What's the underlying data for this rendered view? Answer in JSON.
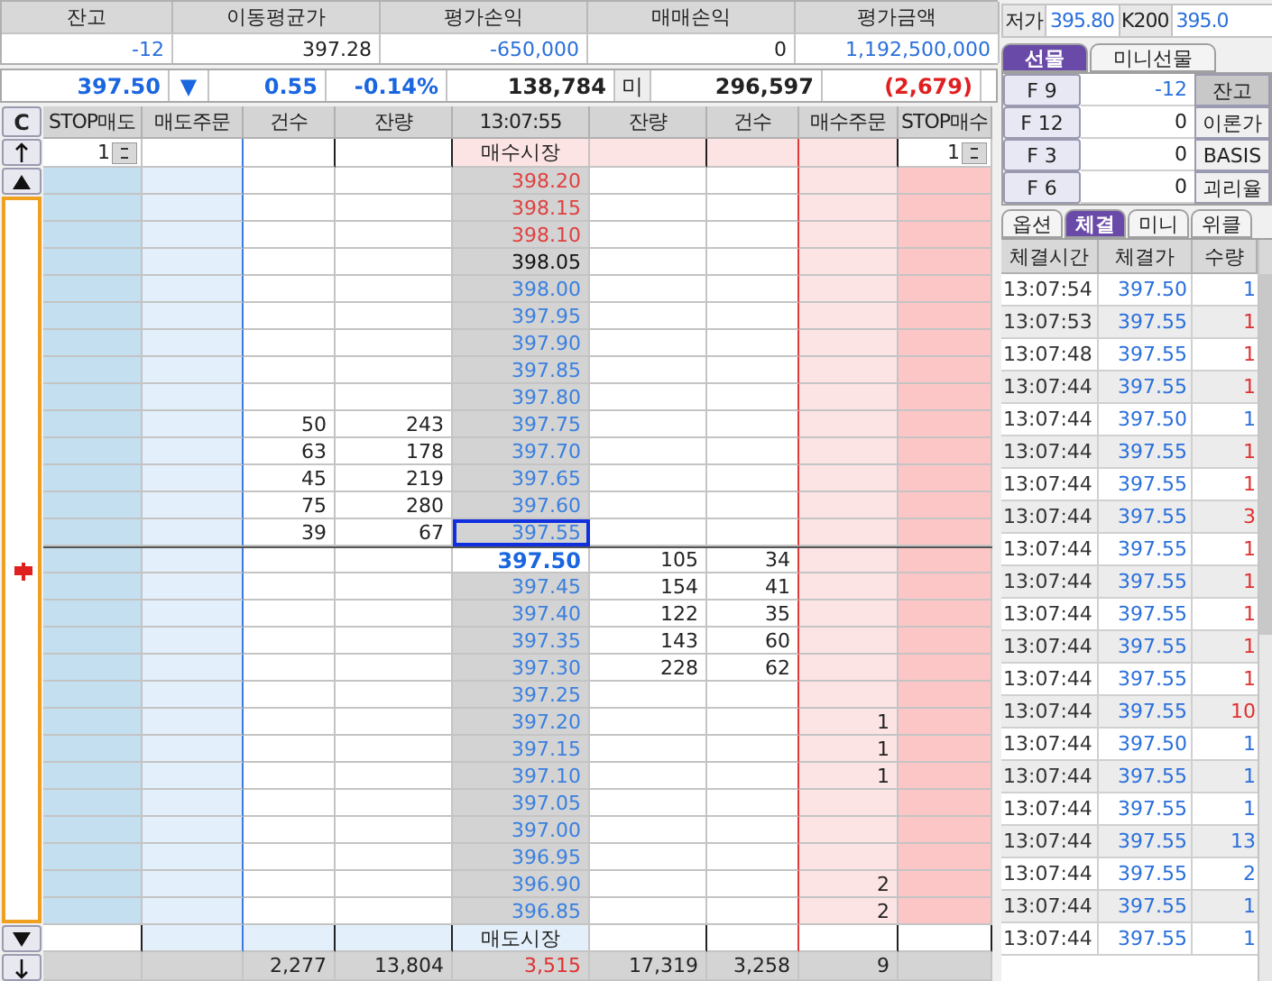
{
  "summary": {
    "columns": [
      "잔고",
      "이동평균가",
      "평가손익",
      "매매손익",
      "평가금액"
    ],
    "values": [
      {
        "text": "-12",
        "color": "#2a6fdb"
      },
      {
        "text": "397.28",
        "color": "#222222"
      },
      {
        "text": "-650,000",
        "color": "#2a6fdb"
      },
      {
        "text": "0",
        "color": "#222222"
      },
      {
        "text": "1,192,500,000",
        "color": "#2a6fdb"
      }
    ]
  },
  "quote": [
    {
      "kind": "value",
      "text": "397.50",
      "color": "#1a66e0"
    },
    {
      "kind": "arrow",
      "text": "▼",
      "color": "#1a66e0"
    },
    {
      "kind": "value",
      "text": "0.55",
      "color": "#1a66e0"
    },
    {
      "kind": "value",
      "text": "-0.14%",
      "color": "#1a66e0"
    },
    {
      "kind": "value",
      "text": "138,784",
      "color": "#222222"
    },
    {
      "kind": "label",
      "text": "미",
      "color": "#222222"
    },
    {
      "kind": "value",
      "text": "296,597",
      "color": "#222222"
    },
    {
      "kind": "value",
      "text": "(2,679)",
      "color": "#e02020"
    }
  ],
  "orderbook": {
    "reset_button": "C",
    "columns": [
      "STOP매도",
      "매도주문",
      "건수",
      "잔량",
      "13:07:55",
      "잔량",
      "건수",
      "매수주문",
      "STOP매수"
    ],
    "buy_market": {
      "label": "매수시장",
      "stop_sell_qty": "1",
      "stop_buy_qty": "1"
    },
    "rows": [
      {
        "price": "398.20",
        "color": "#e04040",
        "ask_count": "",
        "ask_qty": "",
        "bid_qty": "",
        "bid_count": "",
        "buy_order": "",
        "current": false,
        "selected": false
      },
      {
        "price": "398.15",
        "color": "#e04040",
        "ask_count": "",
        "ask_qty": "",
        "bid_qty": "",
        "bid_count": "",
        "buy_order": "",
        "current": false,
        "selected": false
      },
      {
        "price": "398.10",
        "color": "#e04040",
        "ask_count": "",
        "ask_qty": "",
        "bid_qty": "",
        "bid_count": "",
        "buy_order": "",
        "current": false,
        "selected": false
      },
      {
        "price": "398.05",
        "color": "#111111",
        "ask_count": "",
        "ask_qty": "",
        "bid_qty": "",
        "bid_count": "",
        "buy_order": "",
        "current": false,
        "selected": false
      },
      {
        "price": "398.00",
        "color": "#3a80e0",
        "ask_count": "",
        "ask_qty": "",
        "bid_qty": "",
        "bid_count": "",
        "buy_order": "",
        "current": false,
        "selected": false
      },
      {
        "price": "397.95",
        "color": "#3a80e0",
        "ask_count": "",
        "ask_qty": "",
        "bid_qty": "",
        "bid_count": "",
        "buy_order": "",
        "current": false,
        "selected": false
      },
      {
        "price": "397.90",
        "color": "#3a80e0",
        "ask_count": "",
        "ask_qty": "",
        "bid_qty": "",
        "bid_count": "",
        "buy_order": "",
        "current": false,
        "selected": false
      },
      {
        "price": "397.85",
        "color": "#3a80e0",
        "ask_count": "",
        "ask_qty": "",
        "bid_qty": "",
        "bid_count": "",
        "buy_order": "",
        "current": false,
        "selected": false
      },
      {
        "price": "397.80",
        "color": "#3a80e0",
        "ask_count": "",
        "ask_qty": "",
        "bid_qty": "",
        "bid_count": "",
        "buy_order": "",
        "current": false,
        "selected": false
      },
      {
        "price": "397.75",
        "color": "#3a80e0",
        "ask_count": "50",
        "ask_qty": "243",
        "bid_qty": "",
        "bid_count": "",
        "buy_order": "",
        "current": false,
        "selected": false
      },
      {
        "price": "397.70",
        "color": "#3a80e0",
        "ask_count": "63",
        "ask_qty": "178",
        "bid_qty": "",
        "bid_count": "",
        "buy_order": "",
        "current": false,
        "selected": false
      },
      {
        "price": "397.65",
        "color": "#3a80e0",
        "ask_count": "45",
        "ask_qty": "219",
        "bid_qty": "",
        "bid_count": "",
        "buy_order": "",
        "current": false,
        "selected": false
      },
      {
        "price": "397.60",
        "color": "#3a80e0",
        "ask_count": "75",
        "ask_qty": "280",
        "bid_qty": "",
        "bid_count": "",
        "buy_order": "",
        "current": false,
        "selected": false
      },
      {
        "price": "397.55",
        "color": "#3a80e0",
        "ask_count": "39",
        "ask_qty": "67",
        "bid_qty": "",
        "bid_count": "",
        "buy_order": "",
        "current": false,
        "selected": true
      },
      {
        "price": "397.50",
        "color": "#1a66e0",
        "ask_count": "",
        "ask_qty": "",
        "bid_qty": "105",
        "bid_count": "34",
        "buy_order": "",
        "current": true,
        "selected": false
      },
      {
        "price": "397.45",
        "color": "#3a80e0",
        "ask_count": "",
        "ask_qty": "",
        "bid_qty": "154",
        "bid_count": "41",
        "buy_order": "",
        "current": false,
        "selected": false
      },
      {
        "price": "397.40",
        "color": "#3a80e0",
        "ask_count": "",
        "ask_qty": "",
        "bid_qty": "122",
        "bid_count": "35",
        "buy_order": "",
        "current": false,
        "selected": false
      },
      {
        "price": "397.35",
        "color": "#3a80e0",
        "ask_count": "",
        "ask_qty": "",
        "bid_qty": "143",
        "bid_count": "60",
        "buy_order": "",
        "current": false,
        "selected": false
      },
      {
        "price": "397.30",
        "color": "#3a80e0",
        "ask_count": "",
        "ask_qty": "",
        "bid_qty": "228",
        "bid_count": "62",
        "buy_order": "",
        "current": false,
        "selected": false
      },
      {
        "price": "397.25",
        "color": "#3a80e0",
        "ask_count": "",
        "ask_qty": "",
        "bid_qty": "",
        "bid_count": "",
        "buy_order": "",
        "current": false,
        "selected": false
      },
      {
        "price": "397.20",
        "color": "#3a80e0",
        "ask_count": "",
        "ask_qty": "",
        "bid_qty": "",
        "bid_count": "",
        "buy_order": "1",
        "current": false,
        "selected": false
      },
      {
        "price": "397.15",
        "color": "#3a80e0",
        "ask_count": "",
        "ask_qty": "",
        "bid_qty": "",
        "bid_count": "",
        "buy_order": "1",
        "current": false,
        "selected": false
      },
      {
        "price": "397.10",
        "color": "#3a80e0",
        "ask_count": "",
        "ask_qty": "",
        "bid_qty": "",
        "bid_count": "",
        "buy_order": "1",
        "current": false,
        "selected": false
      },
      {
        "price": "397.05",
        "color": "#3a80e0",
        "ask_count": "",
        "ask_qty": "",
        "bid_qty": "",
        "bid_count": "",
        "buy_order": "",
        "current": false,
        "selected": false
      },
      {
        "price": "397.00",
        "color": "#3a80e0",
        "ask_count": "",
        "ask_qty": "",
        "bid_qty": "",
        "bid_count": "",
        "buy_order": "",
        "current": false,
        "selected": false
      },
      {
        "price": "396.95",
        "color": "#3a80e0",
        "ask_count": "",
        "ask_qty": "",
        "bid_qty": "",
        "bid_count": "",
        "buy_order": "",
        "current": false,
        "selected": false
      },
      {
        "price": "396.90",
        "color": "#3a80e0",
        "ask_count": "",
        "ask_qty": "",
        "bid_qty": "",
        "bid_count": "",
        "buy_order": "2",
        "current": false,
        "selected": false
      },
      {
        "price": "396.85",
        "color": "#3a80e0",
        "ask_count": "",
        "ask_qty": "",
        "bid_qty": "",
        "bid_count": "",
        "buy_order": "2",
        "current": false,
        "selected": false
      }
    ],
    "sell_market": "매도시장",
    "totals": {
      "ask_count": "2,277",
      "ask_qty": "13,804",
      "net": "3,515",
      "bid_qty": "17,319",
      "bid_count": "3,258",
      "buy_order": "9"
    }
  },
  "quote_strip": [
    {
      "label": "저가",
      "value": "395.80"
    },
    {
      "label": "K200",
      "value": "395.0"
    }
  ],
  "product_tabs": [
    {
      "label": "선물",
      "selected": true
    },
    {
      "label": "미니선물",
      "selected": false
    }
  ],
  "futures": [
    {
      "label": "F 9",
      "value": "-12",
      "color": "#2a6fdb",
      "button": "잔고",
      "selected": true
    },
    {
      "label": "F 12",
      "value": "0",
      "color": "#222222",
      "button": "이론가",
      "selected": false
    },
    {
      "label": "F 3",
      "value": "0",
      "color": "#222222",
      "button": "BASIS",
      "selected": false
    },
    {
      "label": "F 6",
      "value": "0",
      "color": "#222222",
      "button": "괴리율",
      "selected": false
    }
  ],
  "view_tabs": [
    {
      "label": "옵션",
      "selected": false
    },
    {
      "label": "체결",
      "selected": true
    },
    {
      "label": "미니",
      "selected": false
    },
    {
      "label": "위클",
      "selected": false
    }
  ],
  "trades": {
    "columns": [
      "체결시간",
      "체결가",
      "수량"
    ],
    "rows": [
      {
        "time": "13:07:54",
        "price": "397.50",
        "qty": "1",
        "color": "#2a6fdb"
      },
      {
        "time": "13:07:53",
        "price": "397.55",
        "qty": "1",
        "color": "#e03030"
      },
      {
        "time": "13:07:48",
        "price": "397.55",
        "qty": "1",
        "color": "#e03030"
      },
      {
        "time": "13:07:44",
        "price": "397.55",
        "qty": "1",
        "color": "#e03030"
      },
      {
        "time": "13:07:44",
        "price": "397.50",
        "qty": "1",
        "color": "#2a6fdb"
      },
      {
        "time": "13:07:44",
        "price": "397.55",
        "qty": "1",
        "color": "#e03030"
      },
      {
        "time": "13:07:44",
        "price": "397.55",
        "qty": "1",
        "color": "#e03030"
      },
      {
        "time": "13:07:44",
        "price": "397.55",
        "qty": "3",
        "color": "#e03030"
      },
      {
        "time": "13:07:44",
        "price": "397.55",
        "qty": "1",
        "color": "#e03030"
      },
      {
        "time": "13:07:44",
        "price": "397.55",
        "qty": "1",
        "color": "#e03030"
      },
      {
        "time": "13:07:44",
        "price": "397.55",
        "qty": "1",
        "color": "#e03030"
      },
      {
        "time": "13:07:44",
        "price": "397.55",
        "qty": "1",
        "color": "#e03030"
      },
      {
        "time": "13:07:44",
        "price": "397.55",
        "qty": "1",
        "color": "#e03030"
      },
      {
        "time": "13:07:44",
        "price": "397.55",
        "qty": "10",
        "color": "#e03030"
      },
      {
        "time": "13:07:44",
        "price": "397.50",
        "qty": "1",
        "color": "#2a6fdb"
      },
      {
        "time": "13:07:44",
        "price": "397.55",
        "qty": "1",
        "color": "#2a6fdb"
      },
      {
        "time": "13:07:44",
        "price": "397.55",
        "qty": "1",
        "color": "#2a6fdb"
      },
      {
        "time": "13:07:44",
        "price": "397.55",
        "qty": "13",
        "color": "#2a6fdb"
      },
      {
        "time": "13:07:44",
        "price": "397.55",
        "qty": "2",
        "color": "#2a6fdb"
      },
      {
        "time": "13:07:44",
        "price": "397.55",
        "qty": "1",
        "color": "#2a6fdb"
      },
      {
        "time": "13:07:44",
        "price": "397.55",
        "qty": "1",
        "color": "#2a6fdb"
      }
    ]
  }
}
